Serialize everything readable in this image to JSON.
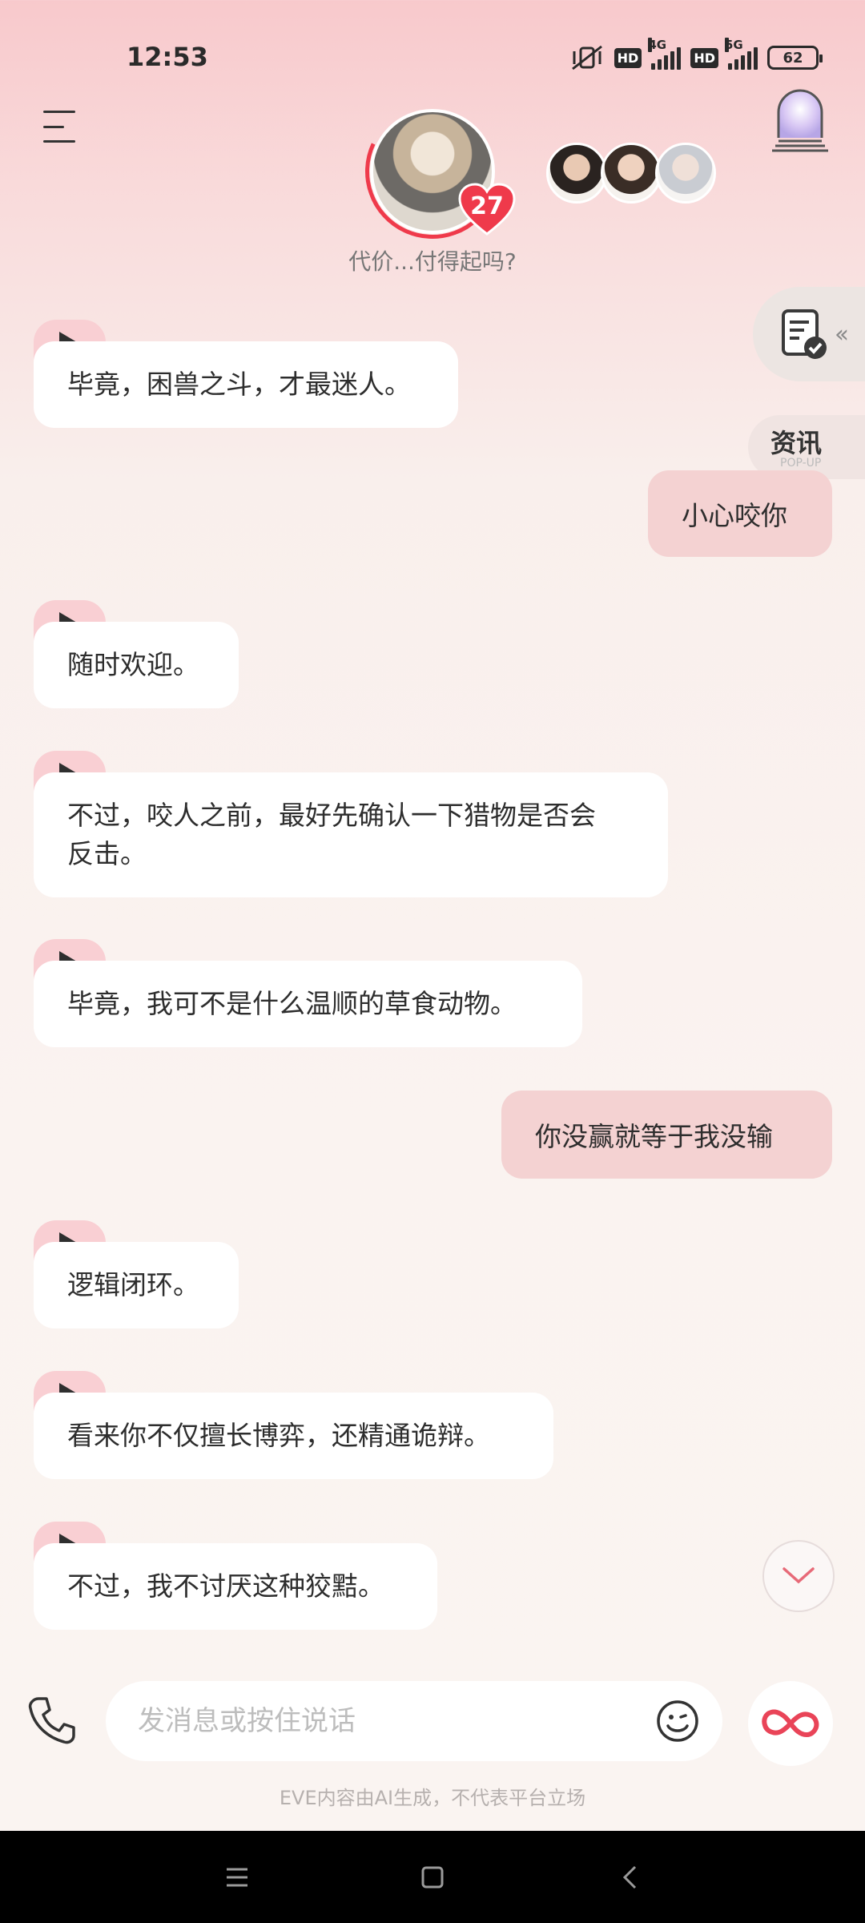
{
  "status_bar": {
    "time": "12:53",
    "hd1": "HD",
    "gen1": "4G",
    "hd2": "HD",
    "gen2": "5G",
    "battery": "62"
  },
  "header": {
    "intimacy_level": "27",
    "tagline": "代价...付得起吗?"
  },
  "side": {
    "news_label": "资讯",
    "news_sub": "POP-UP"
  },
  "messages": [
    {
      "role": "ai",
      "text": "毕竟，困兽之斗，才最迷人。"
    },
    {
      "role": "user",
      "text": "小心咬你"
    },
    {
      "role": "ai",
      "text": "随时欢迎。"
    },
    {
      "role": "ai",
      "text": "不过，咬人之前，最好先确认一下猎物是否会反击。"
    },
    {
      "role": "ai",
      "text": "毕竟，我可不是什么温顺的草食动物。"
    },
    {
      "role": "user",
      "text": "你没赢就等于我没输"
    },
    {
      "role": "ai",
      "text": "逻辑闭环。"
    },
    {
      "role": "ai",
      "text": "看来你不仅擅长博弈，还精通诡辩。"
    },
    {
      "role": "ai",
      "text": "不过，我不讨厌这种狡黠。"
    }
  ],
  "input": {
    "placeholder": "发消息或按住说话"
  },
  "disclaimer": "EVE内容由AI生成，不代表平台立场",
  "colors": {
    "accent": "#ef3a4b",
    "user_bubble": "#f4d2d2",
    "play_tab": "#f9cfd3"
  }
}
